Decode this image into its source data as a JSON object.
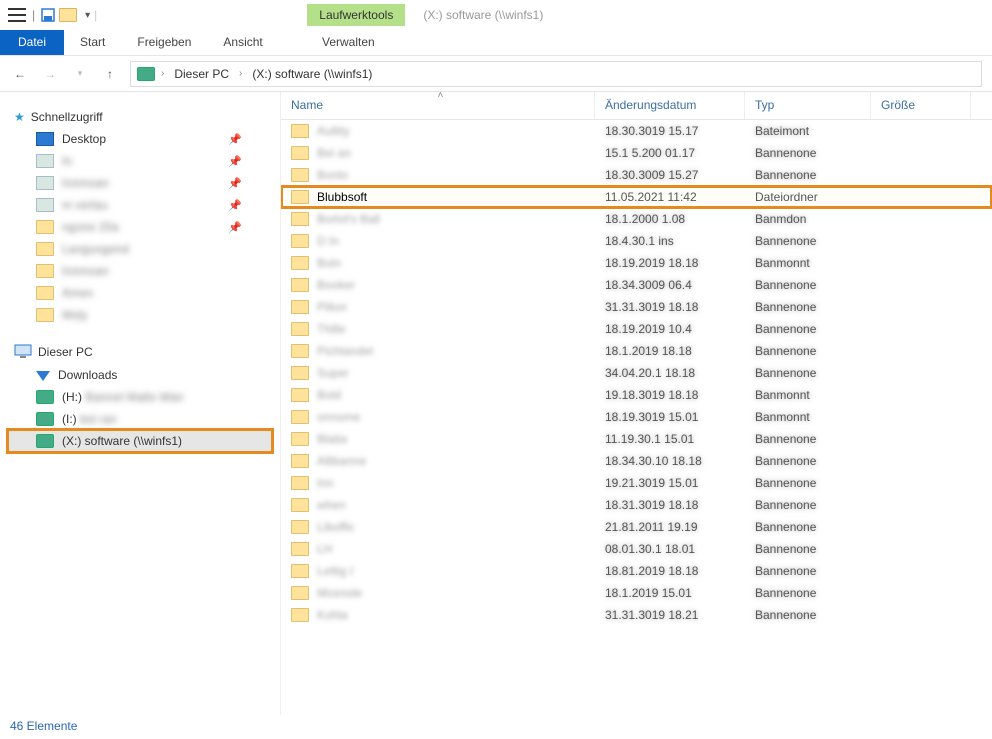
{
  "titlebar": {
    "context_tab": "Laufwerktools",
    "context_sub": "(X:) software (\\\\winfs1)"
  },
  "ribbon": {
    "file": "Datei",
    "tabs": [
      "Start",
      "Freigeben",
      "Ansicht"
    ],
    "ctx": "Verwalten"
  },
  "breadcrumb": {
    "items": [
      "Dieser PC",
      "(X:) software (\\\\winfs1)"
    ]
  },
  "nav": {
    "quick": {
      "label": "Schnellzugriff",
      "items": [
        {
          "label": "Desktop",
          "icon": "desktop",
          "pinned": true,
          "blurred": false
        },
        {
          "label": "In",
          "icon": "generic",
          "pinned": true,
          "blurred": true
        },
        {
          "label": "Innmoan",
          "icon": "generic",
          "pinned": true,
          "blurred": true
        },
        {
          "label": "m verlau",
          "icon": "generic",
          "pinned": true,
          "blurred": true
        },
        {
          "label": "ngone 20a",
          "icon": "folder",
          "pinned": true,
          "blurred": true
        },
        {
          "label": "Languogend",
          "icon": "folder",
          "pinned": false,
          "blurred": true
        },
        {
          "label": "Innmoan",
          "icon": "folder",
          "pinned": false,
          "blurred": true
        },
        {
          "label": "Amen",
          "icon": "folder",
          "pinned": false,
          "blurred": true
        },
        {
          "label": "Moly",
          "icon": "folder",
          "pinned": false,
          "blurred": true
        }
      ]
    },
    "pc": {
      "label": "Dieser PC",
      "items": [
        {
          "label": "Downloads",
          "icon": "dl",
          "blurred": false
        },
        {
          "label": "(H:) Bannet Matts Wan",
          "icon": "drive",
          "blurred": true,
          "prefix": "(H:)"
        },
        {
          "label": "(I:) bst ran",
          "icon": "drive",
          "blurred": true,
          "prefix": "(I:)"
        },
        {
          "label": "(X:) software (\\\\winfs1)",
          "icon": "drive",
          "blurred": false,
          "selected": true,
          "highlight": true
        }
      ]
    }
  },
  "columns": {
    "name": "Name",
    "date": "Änderungsdatum",
    "type": "Typ",
    "size": "Größe"
  },
  "rows": [
    {
      "name": "Aultity",
      "date": "18.30.3019 15.17",
      "type": "Bateimont",
      "blurred": true
    },
    {
      "name": "Bei an",
      "date": "15.1 5.200 01.17",
      "type": "Bannenone",
      "blurred": true
    },
    {
      "name": "Bonto",
      "date": "18.30.3009 15.27",
      "type": "Bannenone",
      "blurred": true
    },
    {
      "name": "Blubbsoft",
      "date": "11.05.2021 11:42",
      "type": "Dateiordner",
      "blurred": false,
      "highlight": true
    },
    {
      "name": "Borlot's Ball",
      "date": "18.1.2000 1.08",
      "type": "Banmdon",
      "blurred": true
    },
    {
      "name": "D In",
      "date": "18.4.30.1 ins",
      "type": "Bannenone",
      "blurred": true
    },
    {
      "name": "Boin",
      "date": "18.19.2019 18.18",
      "type": "Banmonnt",
      "blurred": true
    },
    {
      "name": "Booker",
      "date": "18.34.3009 06.4",
      "type": "Bannenone",
      "blurred": true
    },
    {
      "name": "Pliton",
      "date": "31.31.3019 18.18",
      "type": "Bannenone",
      "blurred": true
    },
    {
      "name": "Thille",
      "date": "18.19.2019 10.4",
      "type": "Bannenone",
      "blurred": true
    },
    {
      "name": "Pichtandel",
      "date": "18.1.2019 18.18",
      "type": "Bannenone",
      "blurred": true
    },
    {
      "name": "Super",
      "date": "34.04.20.1 18.18",
      "type": "Bannenone",
      "blurred": true
    },
    {
      "name": "Bold",
      "date": "19.18.3019 18.18",
      "type": "Banmonnt",
      "blurred": true
    },
    {
      "name": "onnome",
      "date": "18.19.3019 15.01",
      "type": "Banmonnt",
      "blurred": true
    },
    {
      "name": "Blatia",
      "date": "11.19.30.1 15.01",
      "type": "Bannenone",
      "blurred": true
    },
    {
      "name": "Allibanne",
      "date": "18.34.30.10 18.18",
      "type": "Bannenone",
      "blurred": true
    },
    {
      "name": "Inn",
      "date": "19.21.3019 15.01",
      "type": "Bannenone",
      "blurred": true
    },
    {
      "name": "when",
      "date": "18.31.3019 18.18",
      "type": "Bannenone",
      "blurred": true
    },
    {
      "name": "Liboffic",
      "date": "21.81.2011 19.19",
      "type": "Bannenone",
      "blurred": true
    },
    {
      "name": "LH",
      "date": "08.01.30.1 18.01",
      "type": "Bannenone",
      "blurred": true
    },
    {
      "name": "Lettig I",
      "date": "18.81.2019 18.18",
      "type": "Bannenone",
      "blurred": true
    },
    {
      "name": "Mosnole",
      "date": "18.1.2019 15.01",
      "type": "Bannenone",
      "blurred": true
    },
    {
      "name": "Kohla",
      "date": "31.31.3019 18.21",
      "type": "Bannenone",
      "blurred": true
    }
  ],
  "status": {
    "text": "46 Elemente"
  }
}
